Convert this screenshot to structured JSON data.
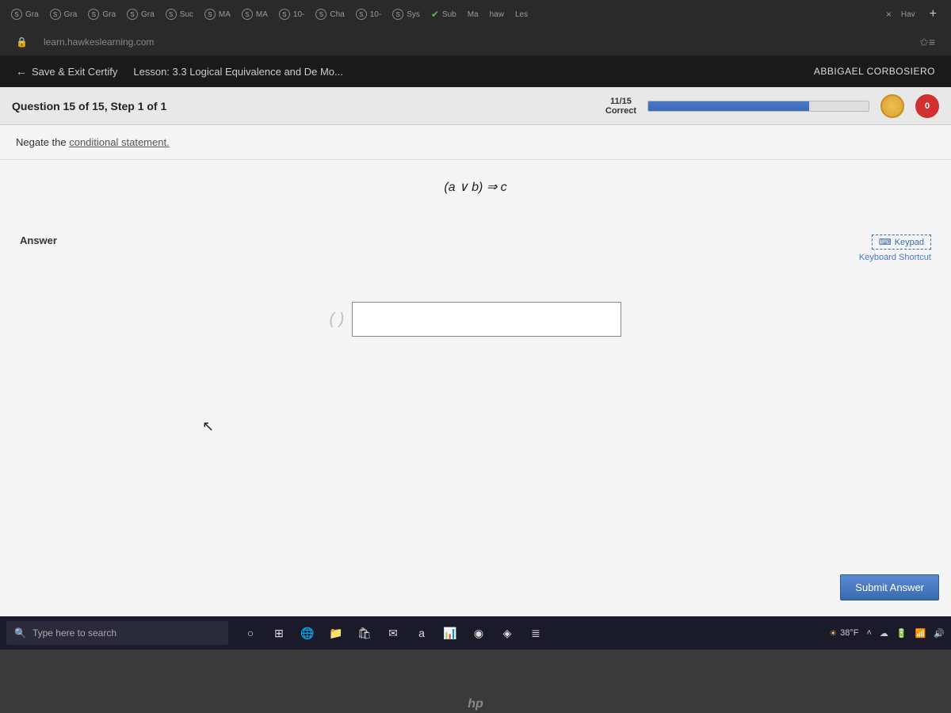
{
  "browser": {
    "tabs": [
      {
        "label": "Gra",
        "icon": "S"
      },
      {
        "label": "Gra",
        "icon": "S"
      },
      {
        "label": "Gra",
        "icon": "S"
      },
      {
        "label": "Gra",
        "icon": "S"
      },
      {
        "label": "Suc",
        "icon": "S"
      },
      {
        "label": "MA",
        "icon": "S"
      },
      {
        "label": "MA",
        "icon": "S"
      },
      {
        "label": "10-",
        "icon": "S"
      },
      {
        "label": "Cha",
        "icon": "S"
      },
      {
        "label": "10-",
        "icon": "S"
      },
      {
        "label": "Sys",
        "icon": "S"
      },
      {
        "label": "Sub",
        "icon": "check"
      },
      {
        "label": "Ma",
        "icon": ""
      },
      {
        "label": "haw",
        "icon": ""
      },
      {
        "label": "Les",
        "icon": ""
      },
      {
        "label": "Hav",
        "icon": ""
      }
    ],
    "url": "learn.hawkeslearning.com"
  },
  "lesson": {
    "save_exit": "Save & Exit Certify",
    "title": "Lesson: 3.3 Logical Equivalence and De Mo...",
    "user": "ABBIGAEL CORBOSIERO"
  },
  "progress": {
    "question_label": "Question 15 of 15, Step 1 of 1",
    "correct_count": "11/15",
    "correct_label": "Correct",
    "percent": 73,
    "heart_value": "0"
  },
  "question": {
    "prompt_prefix": "Negate the ",
    "prompt_link": "conditional statement.",
    "formula": "(a ∨ b) ⇒ c"
  },
  "answer": {
    "label": "Answer",
    "keypad_label": "Keypad",
    "shortcut_label": "Keyboard Shortcut",
    "submit_label": "Submit Answer",
    "input_value": ""
  },
  "taskbar": {
    "search_placeholder": "Type here to search",
    "temp": "38°F"
  },
  "hp": "hp"
}
